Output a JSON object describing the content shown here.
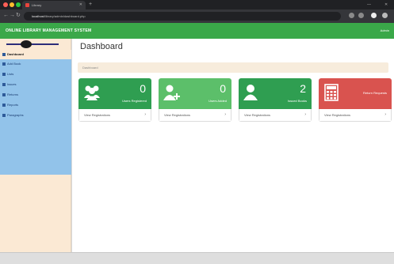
{
  "browser": {
    "tab_title": "Library",
    "url_host": "localhost",
    "url_path": "/library/admin/dashboard.php"
  },
  "header": {
    "brand": "ONLINE LIBRARY MANAGEMENT SYSTEM",
    "user": "Admin"
  },
  "sidebar": {
    "items": [
      {
        "label": "Dashboard",
        "icon": "dashboard-icon"
      },
      {
        "label": "Add Book",
        "icon": "add-icon"
      },
      {
        "label": "Lists",
        "icon": "list-icon"
      },
      {
        "label": "Issues",
        "icon": "issue-icon"
      },
      {
        "label": "Returns",
        "icon": "return-icon"
      },
      {
        "label": "Reports",
        "icon": "report-icon"
      },
      {
        "label": "Paragraphs",
        "icon": "paragraph-icon"
      }
    ]
  },
  "main": {
    "title": "Dashboard",
    "breadcrumb": "Dashboard",
    "cards": [
      {
        "count": "0",
        "label": "Users Registered",
        "footer": "View Registrations",
        "color": "#2f9e51",
        "icon": "users-icon"
      },
      {
        "count": "0",
        "label": "Users Added",
        "footer": "View Registrations",
        "color": "#5cbf6a",
        "icon": "user-plus-icon"
      },
      {
        "count": "2",
        "label": "Issued Books",
        "footer": "View Registrations",
        "color": "#2f9e51",
        "icon": "user-icon"
      },
      {
        "count": "",
        "label": "Return Requests",
        "footer": "View Registrations",
        "color": "#d9534f",
        "icon": "calculator-icon"
      }
    ]
  },
  "colors": {
    "accent_green": "#3aa849",
    "sidebar_bg": "#fbe9d4",
    "sidebar_list": "#92c3ea"
  }
}
